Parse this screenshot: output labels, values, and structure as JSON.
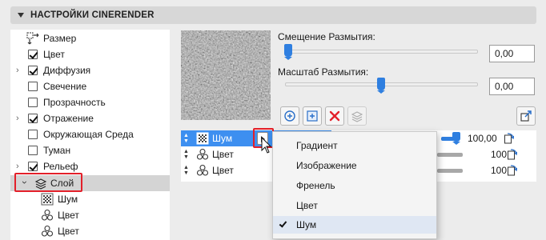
{
  "panel": {
    "title": "НАСТРОЙКИ CINERENDER"
  },
  "tree": {
    "items": [
      {
        "label": "Размер",
        "checkbox": null,
        "chevron": false,
        "icon": "resize-icon"
      },
      {
        "label": "Цвет",
        "checkbox": true,
        "chevron": false
      },
      {
        "label": "Диффузия",
        "checkbox": true,
        "chevron": true
      },
      {
        "label": "Свечение",
        "checkbox": false,
        "chevron": false
      },
      {
        "label": "Прозрачность",
        "checkbox": false,
        "chevron": false
      },
      {
        "label": "Отражение",
        "checkbox": true,
        "chevron": true
      },
      {
        "label": "Окружающая Среда",
        "checkbox": false,
        "chevron": false
      },
      {
        "label": "Туман",
        "checkbox": false,
        "chevron": false
      },
      {
        "label": "Рельеф",
        "checkbox": true,
        "chevron": true
      },
      {
        "label": "Слой",
        "expanded": true,
        "selected": true,
        "icon": "layers-icon"
      },
      {
        "label": "Шум",
        "icon": "noise-icon"
      },
      {
        "label": "Цвет",
        "icon": "color-shader-icon"
      },
      {
        "label": "Цвет",
        "icon": "color-shader-icon"
      }
    ]
  },
  "params": {
    "blur_offset": {
      "label": "Смещение Размытия:",
      "value": "0,00",
      "level": 0.0
    },
    "blur_scale": {
      "label": "Масштаб Размытия:",
      "value": "0,00",
      "level": 0.5
    }
  },
  "toolbar": {
    "buttons": [
      "add-shader-icon",
      "add-layer-icon",
      "delete-icon",
      "duplicate-icon"
    ],
    "export_icon": "export-icon"
  },
  "layers": [
    {
      "name": "Шум",
      "icon": "noise-icon",
      "value": "100,00",
      "selected": true
    },
    {
      "name": "Цвет",
      "icon": "color-shader-icon",
      "value": "100",
      "selected": false
    },
    {
      "name": "Цвет",
      "icon": "color-shader-icon",
      "value": "100",
      "selected": false
    }
  ],
  "context_menu": {
    "items": [
      {
        "label": "Градиент",
        "checked": false
      },
      {
        "label": "Изображение",
        "checked": false
      },
      {
        "label": "Френель",
        "checked": false
      },
      {
        "label": "Цвет",
        "checked": false
      },
      {
        "label": "Шум",
        "checked": true
      }
    ]
  },
  "colors": {
    "accent": "#3d8ff0",
    "highlight": "#e3202a",
    "slider": "#2f7fe0"
  }
}
